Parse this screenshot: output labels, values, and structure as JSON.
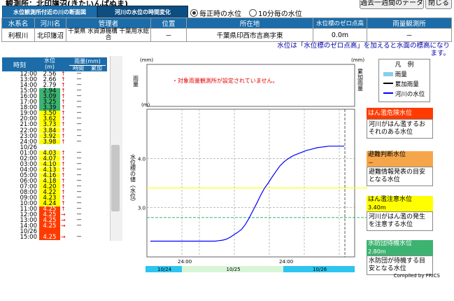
{
  "header": {
    "title": "観測所：北印旛沼(きたいんばぬま)",
    "tab_cross_section": "水位観測所付近の川の断面図",
    "tab_timeline": "河川の水位の時間変化",
    "radio_hourly": "毎正時の水位",
    "radio_10min": "10分毎の水位",
    "radio_selected": "毎正時の水位",
    "btn_week": "過去一週間のデータ",
    "btn_close": "閉じる"
  },
  "info_table": {
    "headers": [
      "水系名",
      "河川名",
      "管理者",
      "位置",
      "所在地",
      "水位標のゼロ点高",
      "雨量観測所"
    ],
    "values": [
      "利根川",
      "北印旛沼",
      "千葉県 水資源機構 千葉用水総合",
      "－",
      "千葉県印西市吉高字東",
      "0.0m",
      "－"
    ]
  },
  "note": "水位は「水位標のゼロ点高」を加えると水面の標高になります。",
  "data_table": {
    "headers": {
      "time": "時刻",
      "level": "水位(m)",
      "rain": "雨量(mm)",
      "rain_hour": "時間",
      "rain_cum": "累加"
    },
    "rows": [
      {
        "t": "12:00",
        "v": "2.56",
        "a": "↑",
        "r1": "－",
        "c": "#ffffff"
      },
      {
        "t": "13:00",
        "v": "2.66",
        "a": "↑",
        "r1": "－",
        "c": "#ffffff"
      },
      {
        "t": "14:00",
        "v": "2.79",
        "a": "↑",
        "r1": "－",
        "c": "#ffffff"
      },
      {
        "t": "15:00",
        "v": "2.94",
        "a": "↑",
        "r1": "－",
        "c": "#3cb371"
      },
      {
        "t": "16:00",
        "v": "3.09",
        "a": "↑",
        "r1": "－",
        "c": "#3cb371"
      },
      {
        "t": "17:00",
        "v": "3.25",
        "a": "↑",
        "r1": "－",
        "c": "#3cb371"
      },
      {
        "t": "18:00",
        "v": "3.39",
        "a": "↑",
        "r1": "－",
        "c": "#3cb371"
      },
      {
        "t": "19:00",
        "v": "3.50",
        "a": "↑",
        "r1": "－",
        "c": "#ffff00"
      },
      {
        "t": "20:00",
        "v": "3.62",
        "a": "↑",
        "r1": "－",
        "c": "#ffff00"
      },
      {
        "t": "21:00",
        "v": "3.73",
        "a": "↑",
        "r1": "－",
        "c": "#ffff00"
      },
      {
        "t": "22:00",
        "v": "3.84",
        "a": "↑",
        "r1": "－",
        "c": "#ffff00"
      },
      {
        "t": "23:00",
        "v": "3.92",
        "a": "↑",
        "r1": "－",
        "c": "#ffff00"
      },
      {
        "t": "24:00",
        "v": "3.98",
        "a": "↑",
        "r1": "－",
        "c": "#ffff00"
      },
      {
        "t": "10/26",
        "v": "",
        "a": "",
        "r1": "",
        "c": "#ffffff"
      },
      {
        "t": "01:00",
        "v": "4.03",
        "a": "↑",
        "r1": "－",
        "c": "#ffff00"
      },
      {
        "t": "02:00",
        "v": "4.07",
        "a": "↑",
        "r1": "－",
        "c": "#ffff00"
      },
      {
        "t": "03:00",
        "v": "4.10",
        "a": "↑",
        "r1": "－",
        "c": "#ffff00"
      },
      {
        "t": "04:00",
        "v": "4.13",
        "a": "↑",
        "r1": "－",
        "c": "#ffff00"
      },
      {
        "t": "05:00",
        "v": "4.16",
        "a": "↑",
        "r1": "－",
        "c": "#ffff00"
      },
      {
        "t": "06:00",
        "v": "4.18",
        "a": "↑",
        "r1": "－",
        "c": "#ffff00"
      },
      {
        "t": "07:00",
        "v": "4.20",
        "a": "↑",
        "r1": "－",
        "c": "#ffff00"
      },
      {
        "t": "08:00",
        "v": "4.22",
        "a": "↑",
        "r1": "－",
        "c": "#ffff00"
      },
      {
        "t": "09:00",
        "v": "4.23",
        "a": "↑",
        "r1": "－",
        "c": "#ffff00"
      },
      {
        "t": "10:00",
        "v": "4.24",
        "a": "↑",
        "r1": "－",
        "c": "#ffff00"
      },
      {
        "t": "11:00",
        "v": "4.25",
        "a": "↑",
        "r1": "－",
        "c": "#ff3b00"
      },
      {
        "t": "12:00",
        "v": "4.25",
        "a": "→",
        "r1": "－",
        "c": "#ff3b00"
      },
      {
        "t": "13:00",
        "v": "4.25",
        "a": "→",
        "r1": "－",
        "c": "#ff3b00"
      },
      {
        "t": "14:00",
        "v": "4.25",
        "a": "→",
        "r1": "－",
        "c": "#ff3b00"
      },
      {
        "t": "10/26",
        "v": "",
        "a": "",
        "r1": "",
        "c": "#ff3b00"
      },
      {
        "t": "15:00",
        "v": "4.25",
        "a": "→",
        "r1": "－",
        "c": "#ff3b00"
      }
    ]
  },
  "rain_panel": {
    "left_label": "雨量",
    "right_label": "累加雨量",
    "unit_left": "(mm)",
    "unit_right": "(mm)",
    "message": "・対象雨量観測所が設定されていません。"
  },
  "chart_data": {
    "type": "line",
    "ylabel": "水位標の値（水位）",
    "yunit": "(m)",
    "ylim": [
      2.0,
      5.0
    ],
    "yticks": [
      3.0,
      4.0
    ],
    "xlabels": [
      "24:00",
      "24:00"
    ],
    "date_bands": [
      "10/24",
      "10/25",
      "10/26"
    ],
    "series": [
      {
        "name": "河川の水位",
        "color": "#0000ff",
        "values": [
          2.32,
          2.32,
          2.32,
          2.32,
          2.32,
          2.32,
          2.32,
          2.32,
          2.32,
          2.32,
          2.32,
          2.32,
          2.32,
          2.32,
          2.32,
          2.32,
          2.32,
          2.32,
          2.33,
          2.34,
          2.36,
          2.4,
          2.45,
          2.5,
          2.56,
          2.66,
          2.79,
          2.94,
          3.09,
          3.25,
          3.39,
          3.5,
          3.62,
          3.73,
          3.84,
          3.92,
          3.98,
          4.03,
          4.07,
          4.1,
          4.13,
          4.16,
          4.18,
          4.2,
          4.22,
          4.23,
          4.24,
          4.25,
          4.25,
          4.25,
          4.25,
          4.25
        ]
      }
    ],
    "thresholds": [
      {
        "name": "はん濫注意水位",
        "value": 3.4,
        "color": "#ffff00"
      },
      {
        "name": "水防団待機水位",
        "value": 2.8,
        "color": "#3cb371"
      }
    ]
  },
  "legend": {
    "title": "凡　例",
    "items": [
      "雨量",
      "累加雨量",
      "河川の水位"
    ],
    "colors": [
      "#87ceeb",
      "#000000",
      "#0000ff"
    ]
  },
  "levels": [
    {
      "title": "はん濫危険水位",
      "value": "",
      "desc": "河川がはん濫するおそれのある水位",
      "color": "#ff3b00",
      "text": "#ffffff"
    },
    {
      "title": "避難判断水位",
      "value": "－",
      "desc": "避難情報発表の目安となる水位",
      "color": "#f6a64a",
      "text": "#000000"
    },
    {
      "title": "はん濫注意水位",
      "value": "3.40m",
      "desc": "河川がはん濫の発生を注意する水位",
      "color": "#ffff00",
      "text": "#000000"
    },
    {
      "title": "水防団待機水位",
      "value": "2.80m",
      "desc": "水防団が待機する目安となる水位",
      "color": "#3cb371",
      "text": "#ffffff"
    }
  ],
  "footer": "Compiled by FRICS"
}
